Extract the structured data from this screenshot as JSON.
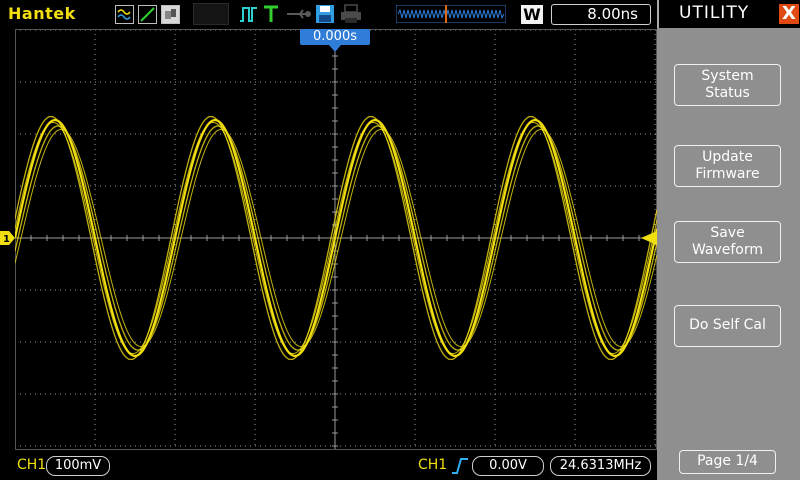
{
  "header": {
    "brand": "Hantek",
    "wave_mode_label": "W",
    "timebase": "8.00ns",
    "icons": [
      "waveform-mode-icon",
      "line-mode-icon",
      "persist-mode-icon",
      "pulse-icon",
      "trigger-t-icon",
      "usb-key-icon",
      "save-disk-icon",
      "printer-icon",
      "memory-depth-bar-icon"
    ]
  },
  "menu": {
    "title": "UTILITY",
    "close_label": "X",
    "buttons": [
      {
        "line1": "System",
        "line2": "Status"
      },
      {
        "line1": "Update",
        "line2": "Firmware"
      },
      {
        "line1": "Save",
        "line2": "Waveform"
      },
      {
        "line1": "Do Self Cal",
        "line2": ""
      }
    ],
    "page": "Page 1/4"
  },
  "screen": {
    "trigger_position": "0.000s",
    "channel_marker": "1",
    "trace_color": "#f2df10",
    "grid_color": "#9a9a9a",
    "accent_color": "#2f7dd8"
  },
  "status": {
    "channel": "CH1",
    "volts_per_div": "100mV",
    "trigger_source": "CH1",
    "trigger_level": "0.00V",
    "frequency": "24.6313MHz"
  }
}
